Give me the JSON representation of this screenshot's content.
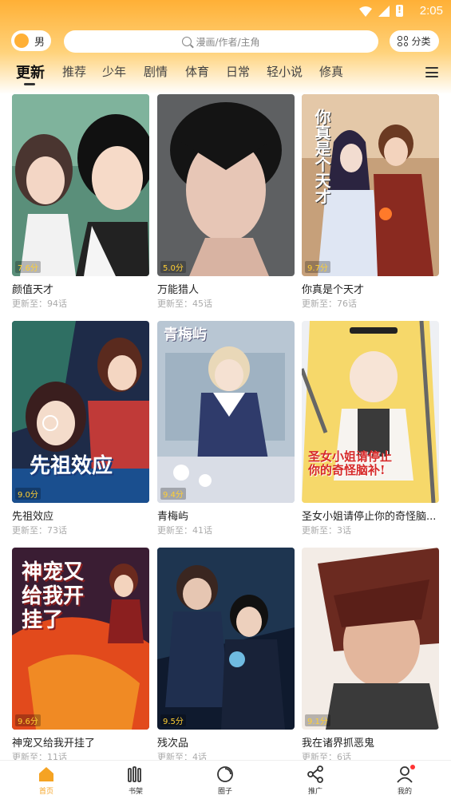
{
  "status": {
    "time": "2:05"
  },
  "header": {
    "gender_label": "男",
    "search_placeholder": "漫画/作者/主角",
    "category_label": "分类"
  },
  "tabs": [
    {
      "label": "更新",
      "active": true
    },
    {
      "label": "推荐"
    },
    {
      "label": "少年"
    },
    {
      "label": "剧情"
    },
    {
      "label": "体育"
    },
    {
      "label": "日常"
    },
    {
      "label": "轻小说"
    },
    {
      "label": "修真"
    }
  ],
  "comics": [
    {
      "title": "颜值天才",
      "update": "更新至：94话",
      "score": "7.6分",
      "cover_text": ""
    },
    {
      "title": "万能猎人",
      "update": "更新至：45话",
      "score": "5.0分",
      "cover_text": ""
    },
    {
      "title": "你真是个天才",
      "update": "更新至：76话",
      "score": "9.7分",
      "cover_text": "你真是个天才"
    },
    {
      "title": "先祖效应",
      "update": "更新至：73话",
      "score": "9.0分",
      "cover_text": "先祖效应"
    },
    {
      "title": "青梅屿",
      "update": "更新至：41话",
      "score": "9.4分",
      "cover_text": "青梅屿"
    },
    {
      "title": "圣女小姐请停止你的奇怪脑...",
      "update": "更新至：3话",
      "score": "",
      "cover_text": "圣女小姐请停止你的奇怪脑补!"
    },
    {
      "title": "神宠又给我开挂了",
      "update": "更新至：11话",
      "score": "9.6分",
      "cover_text": "神宠又给我开挂了"
    },
    {
      "title": "残次品",
      "update": "更新至：4话",
      "score": "9.5分",
      "cover_text": ""
    },
    {
      "title": "我在诸界抓恶鬼",
      "update": "更新至：6话",
      "score": "9.1分",
      "cover_text": ""
    }
  ],
  "bottom_nav": [
    {
      "label": "首页",
      "icon": "home-icon",
      "active": true
    },
    {
      "label": "书架",
      "icon": "bookshelf-icon"
    },
    {
      "label": "圈子",
      "icon": "circle-icon"
    },
    {
      "label": "推广",
      "icon": "share-icon"
    },
    {
      "label": "我的",
      "icon": "user-icon"
    }
  ],
  "colors": {
    "accent": "#ffb036",
    "active_nav": "#f5a323",
    "score": "#ffcf33"
  }
}
